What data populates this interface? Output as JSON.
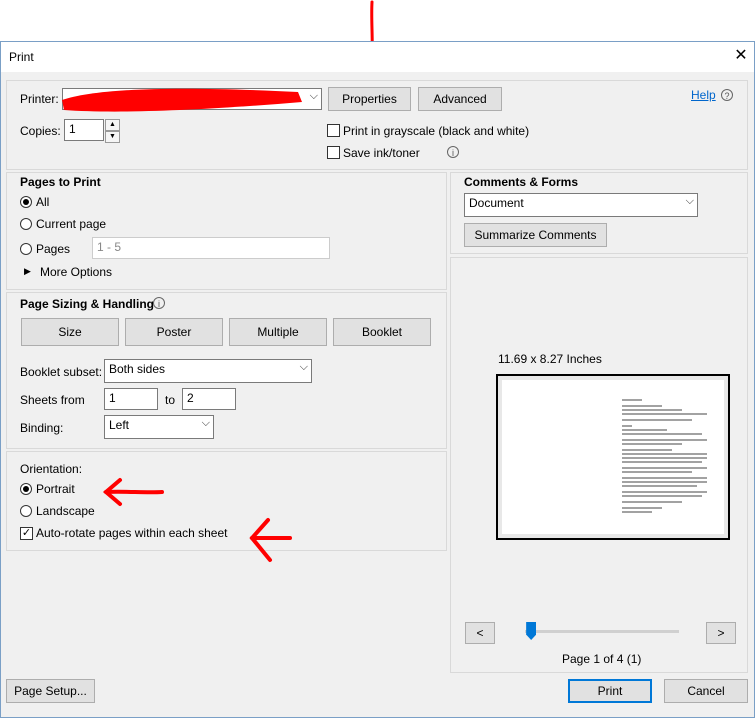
{
  "window": {
    "title": "Print",
    "close_glyph": "✕"
  },
  "printer": {
    "label": "Printer:",
    "properties_label": "Properties",
    "advanced_label": "Advanced",
    "help_label": "Help"
  },
  "copies": {
    "label": "Copies:",
    "value": "1"
  },
  "options": {
    "grayscale_label": "Print in grayscale (black and white)",
    "save_ink_label": "Save ink/toner"
  },
  "pages_to_print": {
    "title": "Pages to Print",
    "all_label": "All",
    "current_label": "Current page",
    "pages_label": "Pages",
    "pages_value": "1 - 5",
    "more_options_label": "More Options"
  },
  "sizing": {
    "title": "Page Sizing & Handling",
    "size_label": "Size",
    "poster_label": "Poster",
    "multiple_label": "Multiple",
    "booklet_label": "Booklet",
    "booklet_subset_label": "Booklet subset:",
    "booklet_subset_value": "Both sides",
    "sheets_from_label": "Sheets from",
    "sheets_from_value": "1",
    "to_label": "to",
    "sheets_to_value": "2",
    "binding_label": "Binding:",
    "binding_value": "Left"
  },
  "orientation": {
    "label": "Orientation:",
    "portrait_label": "Portrait",
    "landscape_label": "Landscape",
    "autorotate_label": "Auto-rotate pages within each sheet"
  },
  "comments": {
    "title": "Comments & Forms",
    "select_value": "Document",
    "summarize_label": "Summarize Comments"
  },
  "preview": {
    "size_label": "11.69 x 8.27 Inches",
    "prev_label": "<",
    "next_label": ">",
    "page_status": "Page 1 of 4 (1)",
    "slider_fraction": 0.04
  },
  "footer": {
    "page_setup_label": "Page Setup...",
    "print_label": "Print",
    "cancel_label": "Cancel"
  },
  "colors": {
    "annotation": "#ff0000",
    "accent": "#0078d7",
    "link": "#0066cc"
  },
  "icons": [
    "down-arrow-annotation-icon",
    "close-icon",
    "help-info-icon",
    "info-icon",
    "chevron-down-icon",
    "triangle-right-icon",
    "left-arrow-annotation-icon"
  ]
}
